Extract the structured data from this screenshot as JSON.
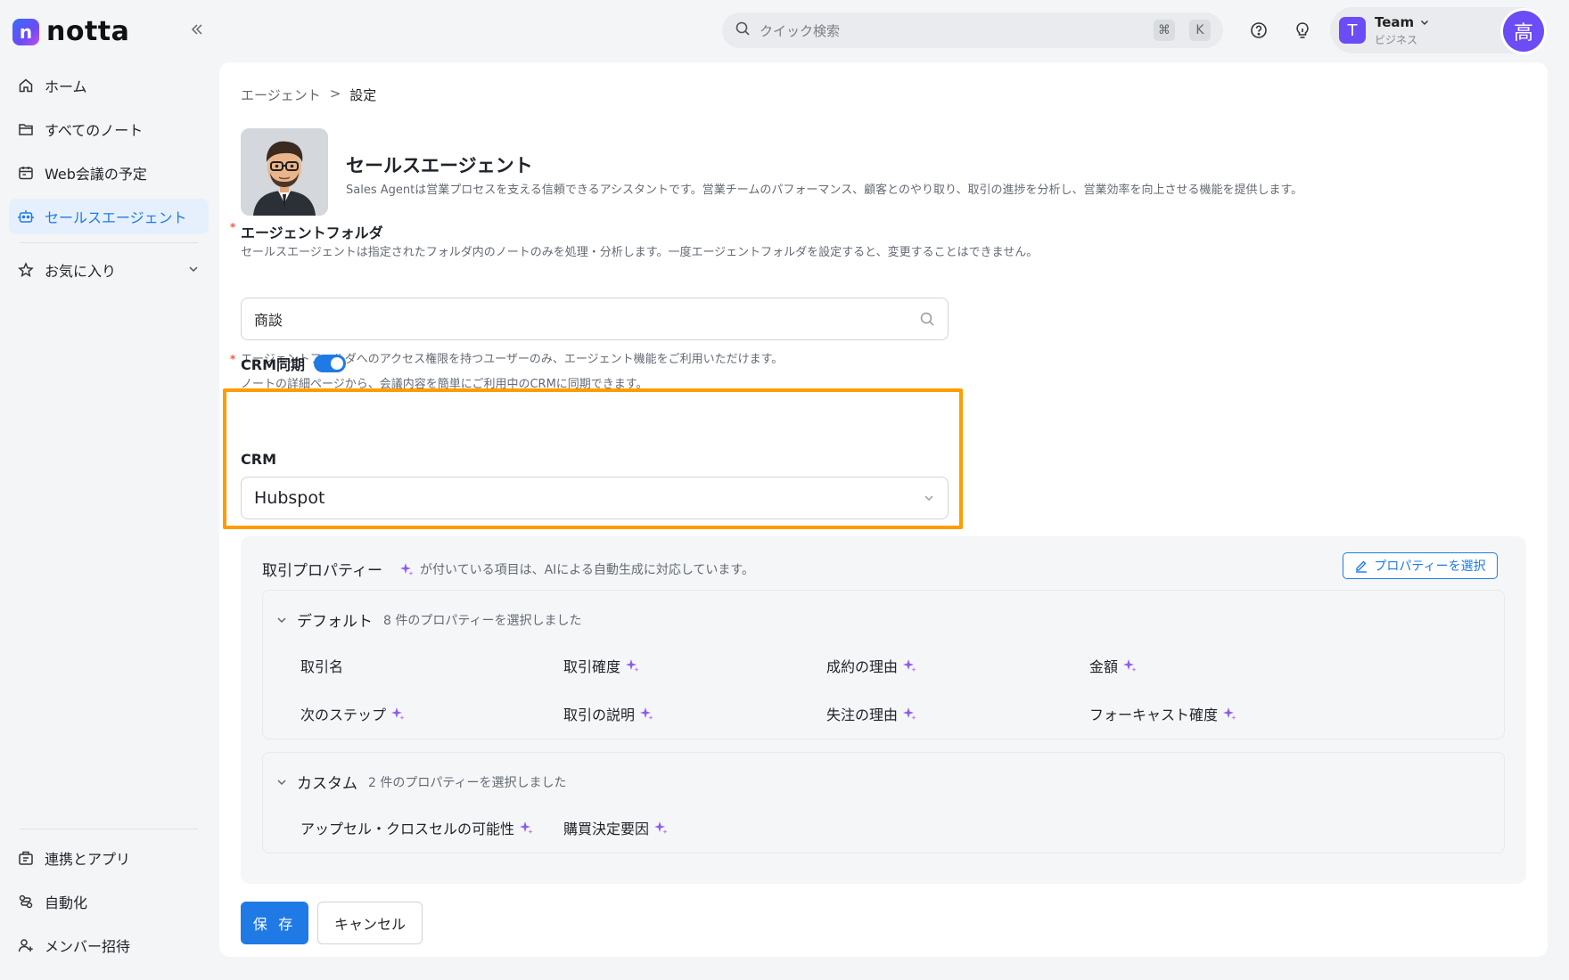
{
  "app": {
    "logo_text": "notta",
    "logo_letter": "n",
    "brand_color": "#3b6cf6"
  },
  "sidebar": {
    "collapse_icon": "double-chevron-left-icon",
    "items": [
      {
        "label": "ホーム",
        "icon": "home-icon"
      },
      {
        "label": "すべてのノート",
        "icon": "folder-icon"
      },
      {
        "label": "Web会議の予定",
        "icon": "calendar-icon"
      },
      {
        "label": "セールスエージェント",
        "icon": "robot-icon",
        "active": true
      }
    ],
    "favorites": {
      "label": "お気に入り",
      "icon": "star-icon"
    },
    "bottom_items": [
      {
        "label": "連携とアプリ",
        "icon": "apps-icon"
      },
      {
        "label": "自動化",
        "icon": "automation-icon"
      },
      {
        "label": "メンバー招待",
        "icon": "invite-member-icon"
      }
    ]
  },
  "topbar": {
    "search_placeholder": "クイック検索",
    "shortcut_keys": [
      "⌘",
      "K"
    ],
    "team": {
      "name": "Team",
      "plan": "ビジネス",
      "avatar_letter": "T"
    },
    "user_avatar_letter": "高"
  },
  "breadcrumb": {
    "parent": "エージェント",
    "separator": ">",
    "current": "設定"
  },
  "agent": {
    "name": "セールスエージェント",
    "description": "Sales Agentは営業プロセスを支える信頼できるアシスタントです。営業チームのパフォーマンス、顧客とのやり取り、取引の進捗を分析し、営業効率を向上させる機能を提供します。"
  },
  "folder_field": {
    "required_mark": "*",
    "label": "エージェントフォルダ",
    "help": "セールスエージェントは指定されたフォルダ内のノートのみを処理・分析します。一度エージェントフォルダを設定すると、変更することはできません。",
    "value": "商談",
    "access_note": "エージェントフォルダへのアクセス権限を持つユーザーのみ、エージェント機能をご利用いただけます。"
  },
  "crm_sync": {
    "required_mark": "*",
    "label": "CRM同期",
    "enabled": true,
    "help": "ノートの詳細ページから、会議内容を簡単にご利用中のCRMに同期できます。",
    "crm_label": "CRM",
    "crm_value": "Hubspot",
    "highlight_color": "#ff9c00"
  },
  "deal_properties": {
    "title": "取引プロパティー",
    "note": "が付いている項目は、AIによる自動生成に対応しています。",
    "select_button": "プロパティーを選択",
    "default_group": {
      "title": "デフォルト",
      "count_text": "8 件のプロパティーを選択しました",
      "items": [
        {
          "label": "取引名",
          "ai": false
        },
        {
          "label": "取引確度",
          "ai": true
        },
        {
          "label": "成約の理由",
          "ai": true
        },
        {
          "label": "金額",
          "ai": true
        },
        {
          "label": "次のステップ",
          "ai": true
        },
        {
          "label": "取引の説明",
          "ai": true
        },
        {
          "label": "失注の理由",
          "ai": true
        },
        {
          "label": "フォーキャスト確度",
          "ai": true
        }
      ]
    },
    "custom_group": {
      "title": "カスタム",
      "count_text": "2 件のプロパティーを選択しました",
      "items": [
        {
          "label": "アップセル・クロスセルの可能性",
          "ai": true
        },
        {
          "label": "購買決定要因",
          "ai": true
        }
      ]
    }
  },
  "actions": {
    "save": "保 存",
    "cancel": "キャンセル"
  }
}
